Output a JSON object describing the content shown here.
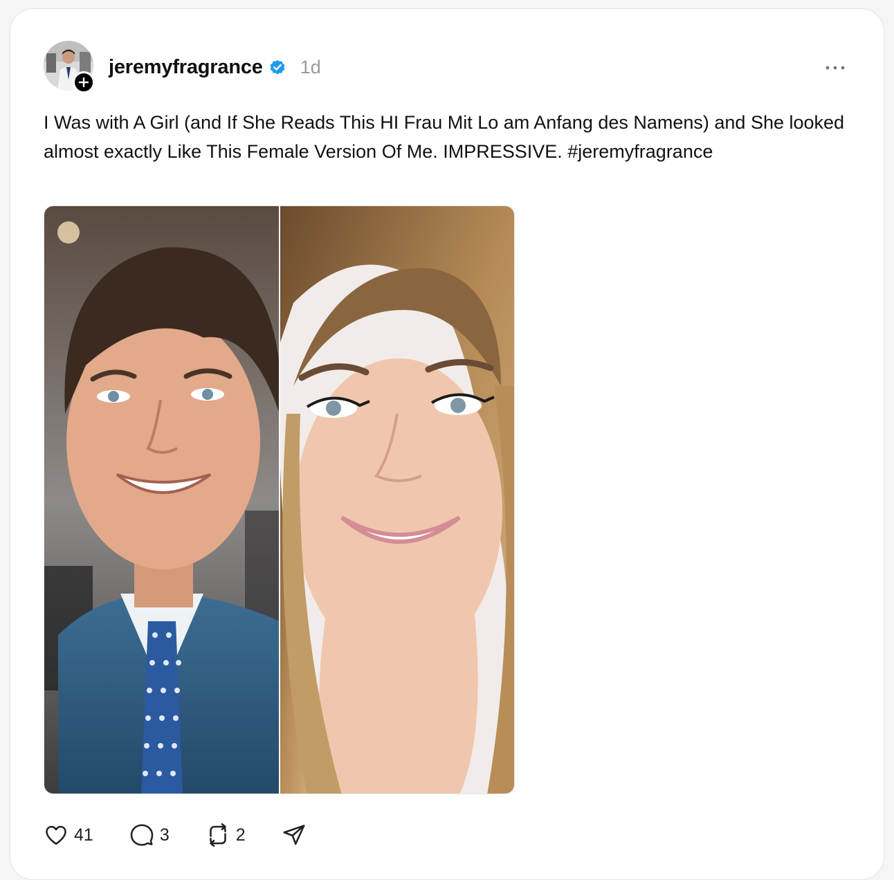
{
  "post": {
    "username": "jeremyfragrance",
    "verified_icon": "verified-badge-icon",
    "verified_color": "#1d9bf0",
    "timestamp": "1d",
    "text": "I Was with A Girl (and If She Reads This HI Frau Mit Lo am Anfang des Namens) and She looked almost exactly Like This Female Version Of Me. IMPRESSIVE. #jeremyfragrance",
    "image_alt": "Side-by-side portraits: a smiling man in a blue suit with a patterned tie, and a smiling woman with long wavy blonde hair",
    "actions": {
      "likes": "41",
      "replies": "3",
      "reposts": "2"
    }
  }
}
